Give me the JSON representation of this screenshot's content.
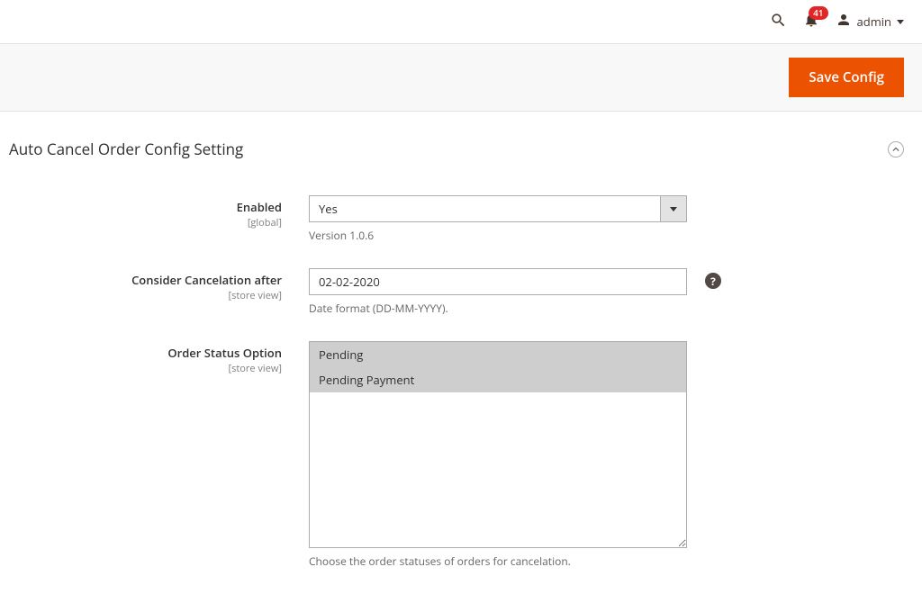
{
  "header": {
    "notifications_count": "41",
    "admin_name": "admin"
  },
  "actionbar": {
    "save_label": "Save Config"
  },
  "section": {
    "title": "Auto Cancel Order Config Setting"
  },
  "fields": {
    "enabled": {
      "label": "Enabled",
      "scope": "[global]",
      "value": "Yes",
      "hint": "Version 1.0.6"
    },
    "cancel_after": {
      "label": "Consider Cancelation after",
      "scope": "[store view]",
      "value": "02-02-2020",
      "hint": "Date format (DD-MM-YYYY).",
      "tooltip": "?"
    },
    "order_status": {
      "label": "Order Status Option",
      "scope": "[store view]",
      "options": [
        "Pending",
        "Pending Payment"
      ],
      "hint": "Choose the order statuses of orders for cancelation."
    }
  }
}
